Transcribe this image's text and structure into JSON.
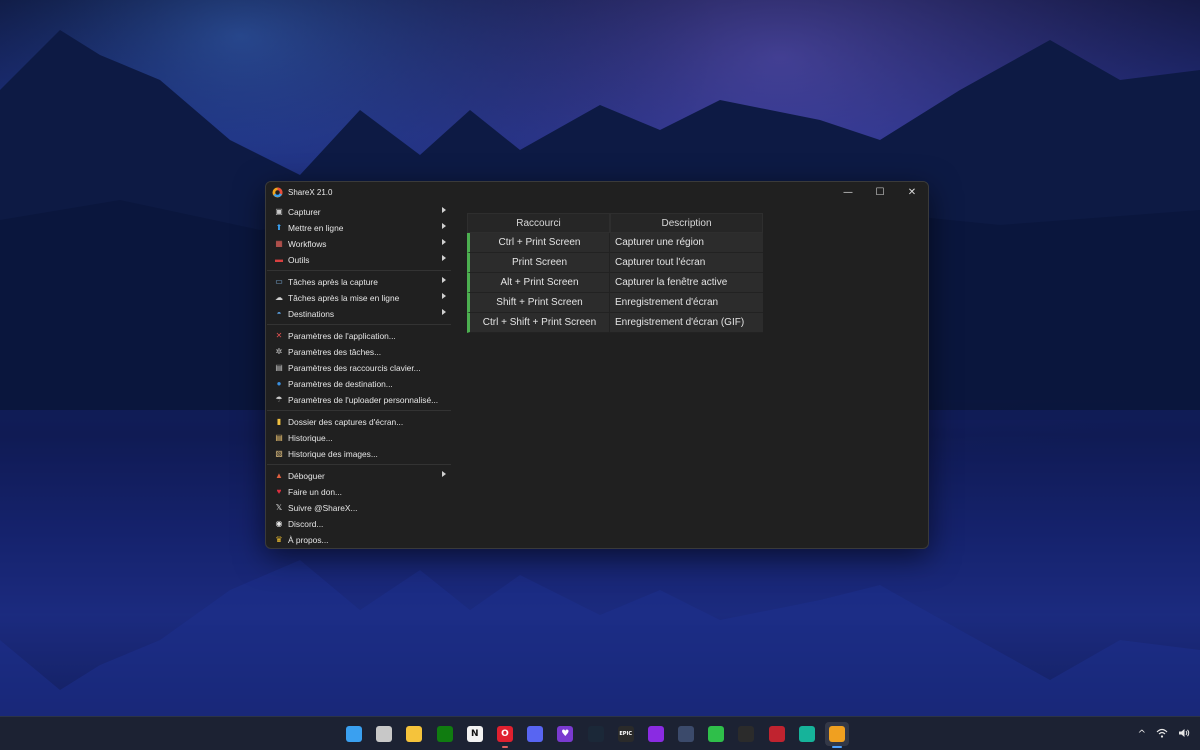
{
  "window": {
    "title": "ShareX 21.0",
    "controls": {
      "minimize": "—",
      "maximize": "☐",
      "close": "✕"
    }
  },
  "menu": {
    "groups": [
      [
        {
          "label": "Capturer",
          "icon": "camera-icon",
          "submenu": true
        },
        {
          "label": "Mettre en ligne",
          "icon": "upload-arrow-icon",
          "submenu": true
        },
        {
          "label": "Workflows",
          "icon": "grid-icon",
          "submenu": true
        },
        {
          "label": "Outils",
          "icon": "toolbox-icon",
          "submenu": true
        }
      ],
      [
        {
          "label": "Tâches après la capture",
          "icon": "image-task-icon",
          "submenu": true
        },
        {
          "label": "Tâches après la mise en ligne",
          "icon": "cloud-upload-icon",
          "submenu": true
        },
        {
          "label": "Destinations",
          "icon": "destinations-icon",
          "submenu": true
        }
      ],
      [
        {
          "label": "Paramètres de l'application...",
          "icon": "wrench-icon",
          "submenu": false
        },
        {
          "label": "Paramètres des tâches...",
          "icon": "gear-icon",
          "submenu": false
        },
        {
          "label": "Paramètres des raccourcis clavier...",
          "icon": "keyboard-icon",
          "submenu": false
        },
        {
          "label": "Paramètres de destination...",
          "icon": "globe-icon",
          "submenu": false
        },
        {
          "label": "Paramètres de l'uploader personnalisé...",
          "icon": "cloud-icon",
          "submenu": false
        }
      ],
      [
        {
          "label": "Dossier des captures d'écran...",
          "icon": "folder-icon",
          "submenu": false
        },
        {
          "label": "Historique...",
          "icon": "history-icon",
          "submenu": false
        },
        {
          "label": "Historique des images...",
          "icon": "image-history-icon",
          "submenu": false
        }
      ],
      [
        {
          "label": "Déboguer",
          "icon": "bug-icon",
          "submenu": true
        },
        {
          "label": "Faire un don...",
          "icon": "heart-icon",
          "submenu": false
        },
        {
          "label": "Suivre @ShareX...",
          "icon": "x-logo-icon",
          "submenu": false
        },
        {
          "label": "Discord...",
          "icon": "discord-icon",
          "submenu": false
        },
        {
          "label": "À propos...",
          "icon": "crown-icon",
          "submenu": false
        }
      ]
    ]
  },
  "hotkeys": {
    "headers": {
      "shortcut": "Raccourci",
      "description": "Description"
    },
    "rows": [
      {
        "key": "Ctrl + Print Screen",
        "description": "Capturer une région"
      },
      {
        "key": "Print Screen",
        "description": "Capturer tout l'écran"
      },
      {
        "key": "Alt + Print Screen",
        "description": "Capturer la fenêtre active"
      },
      {
        "key": "Shift + Print Screen",
        "description": "Enregistrement d'écran"
      },
      {
        "key": "Ctrl + Shift + Print Screen",
        "description": "Enregistrement d'écran (GIF)"
      }
    ],
    "status_color": "#4caf50"
  },
  "taskbar": {
    "apps": [
      {
        "name": "windows-start-icon",
        "glyph": "",
        "color": "#3aa0f0",
        "state": ""
      },
      {
        "name": "task-view-icon",
        "glyph": "",
        "color": "#c8c8c8",
        "state": ""
      },
      {
        "name": "file-explorer-icon",
        "glyph": "",
        "color": "#f5c33b",
        "state": ""
      },
      {
        "name": "xbox-app-icon",
        "glyph": "",
        "color": "#107c10",
        "state": ""
      },
      {
        "name": "notion-icon",
        "glyph": "N",
        "color": "#f2f2f2",
        "state": ""
      },
      {
        "name": "opera-icon",
        "glyph": "O",
        "color": "#e0202f",
        "state": "running"
      },
      {
        "name": "discord-app-icon",
        "glyph": "",
        "color": "#5865f2",
        "state": ""
      },
      {
        "name": "heart-app-icon",
        "glyph": "♥",
        "color": "#7a3ad0",
        "state": ""
      },
      {
        "name": "steam-icon",
        "glyph": "",
        "color": "#1b2838",
        "state": ""
      },
      {
        "name": "epic-games-icon",
        "glyph": "EPIC",
        "color": "#2a2a2a",
        "state": ""
      },
      {
        "name": "circle-app-icon",
        "glyph": "",
        "color": "#8a2be2",
        "state": ""
      },
      {
        "name": "davinci-resolve-icon",
        "glyph": "",
        "color": "#3b4a6b",
        "state": ""
      },
      {
        "name": "elgato-icon",
        "glyph": "",
        "color": "#2fbf4a",
        "state": ""
      },
      {
        "name": "obs-icon",
        "glyph": "",
        "color": "#2b2b2b",
        "state": ""
      },
      {
        "name": "red-app-icon",
        "glyph": "",
        "color": "#c0232f",
        "state": ""
      },
      {
        "name": "teal-app-icon",
        "glyph": "",
        "color": "#16b39a",
        "state": ""
      },
      {
        "name": "sharex-taskbar-icon",
        "glyph": "",
        "color": "#f0a020",
        "state": "active"
      }
    ],
    "tray": {
      "chevron": "^",
      "wifi": "wifi-icon",
      "volume": "volume-icon"
    }
  }
}
